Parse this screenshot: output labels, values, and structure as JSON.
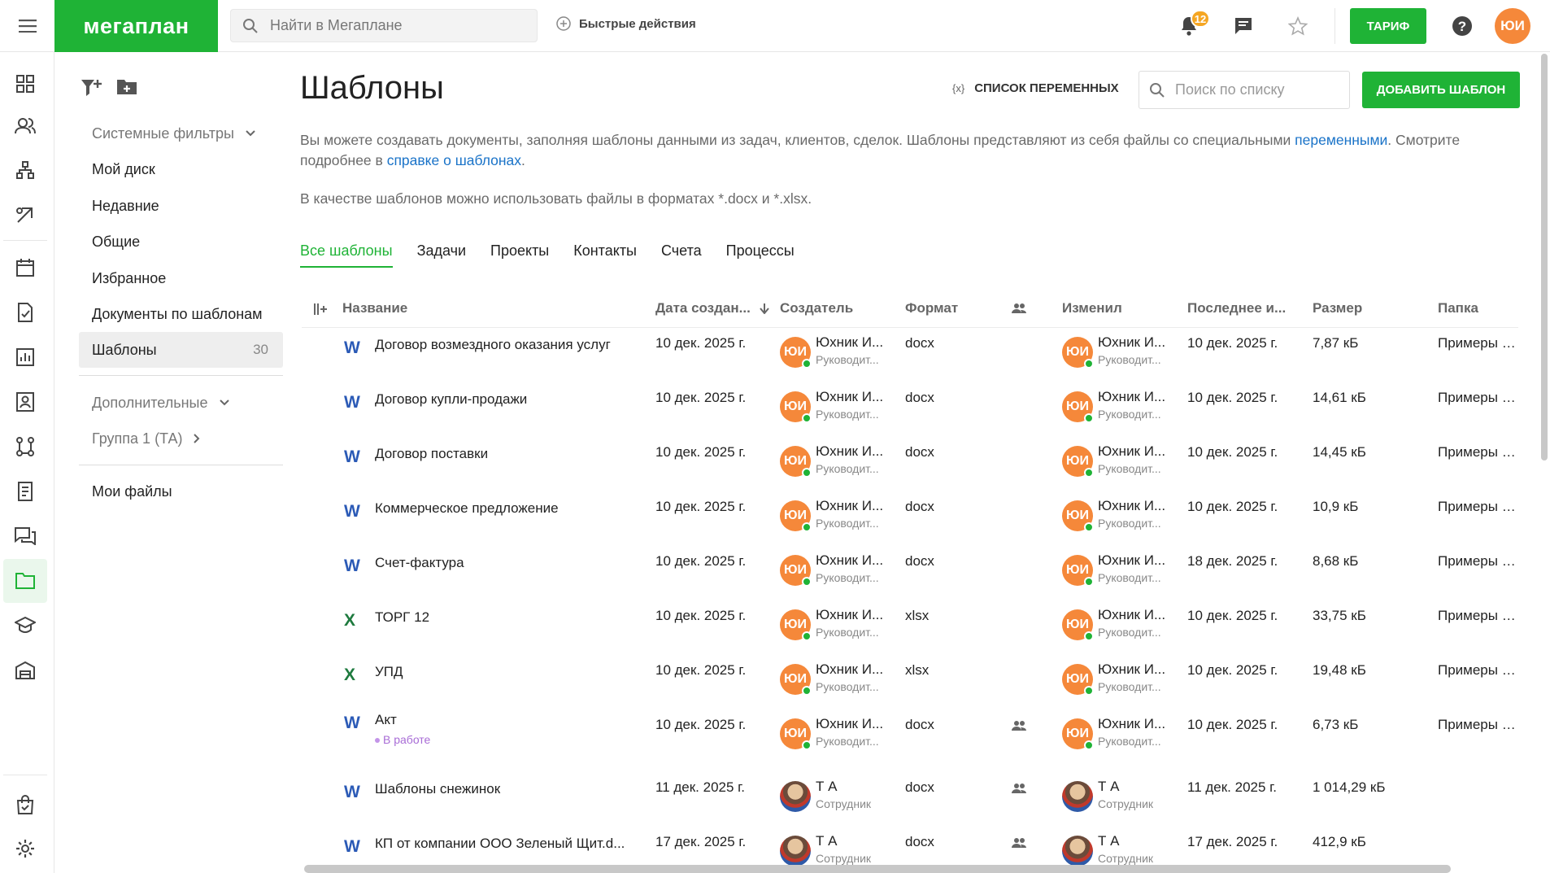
{
  "app": {
    "logo": "мегаплан",
    "search_placeholder": "Найти в Мегаплане",
    "quick_actions": "Быстрые действия",
    "notifications_count": "12",
    "tarif": "ТАРИФ",
    "user_initials": "ЮИ",
    "colors": {
      "brand": "#1fb336",
      "link": "#1a73c8",
      "avatar": "#f5883a",
      "badge": "#f5a623"
    }
  },
  "rail": {
    "icons": [
      "dashboard-icon",
      "clients-icon",
      "structure-icon",
      "deals-icon",
      "calendar-icon",
      "tasks-icon",
      "reports-icon",
      "contacts-icon",
      "processes-icon",
      "invoices-icon",
      "discussions-icon",
      "documents-icon",
      "learning-icon",
      "warehouse-icon",
      "store-icon",
      "settings-icon"
    ],
    "active": "documents-icon"
  },
  "sidebar": {
    "system_filters": "Системные фильтры",
    "items": [
      {
        "label": "Мой диск"
      },
      {
        "label": "Недавние"
      },
      {
        "label": "Общие"
      },
      {
        "label": "Избранное"
      },
      {
        "label": "Документы по шаблонам"
      },
      {
        "label": "Шаблоны",
        "count": "30"
      }
    ],
    "extra": "Дополнительные",
    "group": "Группа 1 (ТА)",
    "my_files": "Мои файлы"
  },
  "main": {
    "title": "Шаблоны",
    "var_list": "СПИСОК ПЕРЕМЕННЫХ",
    "var_icon_text": "{x}",
    "search_placeholder": "Поиск по списку",
    "add_button": "ДОБАВИТЬ ШАБЛОН",
    "desc_part1": "Вы можете создавать документы, заполняя шаблоны данными из задач, клиентов, сделок. Шаблоны представляют из себя файлы со специальными ",
    "desc_link1": "переменными",
    "desc_part2": ". Смотрите подробнее в ",
    "desc_link2": "справке о шаблонах",
    "desc_part3": ".",
    "desc_formats": "В качестве шаблонов можно использовать файлы в форматах *.docx и *.xlsx.",
    "tabs": [
      "Все шаблоны",
      "Задачи",
      "Проекты",
      "Контакты",
      "Счета",
      "Процессы"
    ]
  },
  "table": {
    "columns": {
      "name": "Название",
      "created": "Дата создан...",
      "creator": "Создатель",
      "format": "Формат",
      "changed_by": "Изменил",
      "last": "Последнее и...",
      "size": "Размер",
      "folder": "Папка"
    },
    "rows": [
      {
        "type": "W",
        "name": "Договор возмездного оказания услуг",
        "created": "10 дек. 2025 г.",
        "creator": "Юхник И...",
        "creator_role": "Руководит...",
        "format": "docx",
        "shared": false,
        "changer": "Юхник И...",
        "changer_role": "Руководит...",
        "last": "10 дек. 2025 г.",
        "size": "7,87 кБ",
        "folder": "Примеры ш..."
      },
      {
        "type": "W",
        "name": "Договор купли-продажи",
        "created": "10 дек. 2025 г.",
        "creator": "Юхник И...",
        "creator_role": "Руководит...",
        "format": "docx",
        "shared": false,
        "changer": "Юхник И...",
        "changer_role": "Руководит...",
        "last": "10 дек. 2025 г.",
        "size": "14,61 кБ",
        "folder": "Примеры ш..."
      },
      {
        "type": "W",
        "name": "Договор поставки",
        "created": "10 дек. 2025 г.",
        "creator": "Юхник И...",
        "creator_role": "Руководит...",
        "format": "docx",
        "shared": false,
        "changer": "Юхник И...",
        "changer_role": "Руководит...",
        "last": "10 дек. 2025 г.",
        "size": "14,45 кБ",
        "folder": "Примеры ш..."
      },
      {
        "type": "W",
        "name": "Коммерческое предложение",
        "created": "10 дек. 2025 г.",
        "creator": "Юхник И...",
        "creator_role": "Руководит...",
        "format": "docx",
        "shared": false,
        "changer": "Юхник И...",
        "changer_role": "Руководит...",
        "last": "10 дек. 2025 г.",
        "size": "10,9 кБ",
        "folder": "Примеры ш..."
      },
      {
        "type": "W",
        "name": "Счет-фактура",
        "created": "10 дек. 2025 г.",
        "creator": "Юхник И...",
        "creator_role": "Руководит...",
        "format": "docx",
        "shared": false,
        "changer": "Юхник И...",
        "changer_role": "Руководит...",
        "last": "18 дек. 2025 г.",
        "size": "8,68 кБ",
        "folder": "Примеры ш..."
      },
      {
        "type": "X",
        "name": "ТОРГ 12",
        "created": "10 дек. 2025 г.",
        "creator": "Юхник И...",
        "creator_role": "Руководит...",
        "format": "xlsx",
        "shared": false,
        "changer": "Юхник И...",
        "changer_role": "Руководит...",
        "last": "10 дек. 2025 г.",
        "size": "33,75 кБ",
        "folder": "Примеры ш..."
      },
      {
        "type": "X",
        "name": "УПД",
        "created": "10 дек. 2025 г.",
        "creator": "Юхник И...",
        "creator_role": "Руководит...",
        "format": "xlsx",
        "shared": false,
        "changer": "Юхник И...",
        "changer_role": "Руководит...",
        "last": "10 дек. 2025 г.",
        "size": "19,48 кБ",
        "folder": "Примеры ш..."
      },
      {
        "type": "W",
        "name": "Акт",
        "status": "В работе",
        "created": "10 дек. 2025 г.",
        "creator": "Юхник И...",
        "creator_role": "Руководит...",
        "format": "docx",
        "shared": true,
        "changer": "Юхник И...",
        "changer_role": "Руководит...",
        "last": "10 дек. 2025 г.",
        "size": "6,73 кБ",
        "folder": "Примеры ш..."
      },
      {
        "type": "W",
        "name": "Шаблоны снежинок",
        "created": "11 дек. 2025 г.",
        "creator": "Т А",
        "creator_role": "Сотрудник",
        "creator_photo": true,
        "format": "docx",
        "shared": true,
        "changer": "Т А",
        "changer_role": "Сотрудник",
        "changer_photo": true,
        "last": "11 дек. 2025 г.",
        "size": "1 014,29 кБ",
        "folder": ""
      },
      {
        "type": "W",
        "name": "КП от компании ООО Зеленый Щит.d...",
        "created": "17 дек. 2025 г.",
        "creator": "Т А",
        "creator_role": "Сотрудник",
        "creator_photo": true,
        "format": "docx",
        "shared": true,
        "changer": "Т А",
        "changer_role": "Сотрудник",
        "changer_photo": true,
        "last": "17 дек. 2025 г.",
        "size": "412,9 кБ",
        "folder": ""
      }
    ]
  }
}
